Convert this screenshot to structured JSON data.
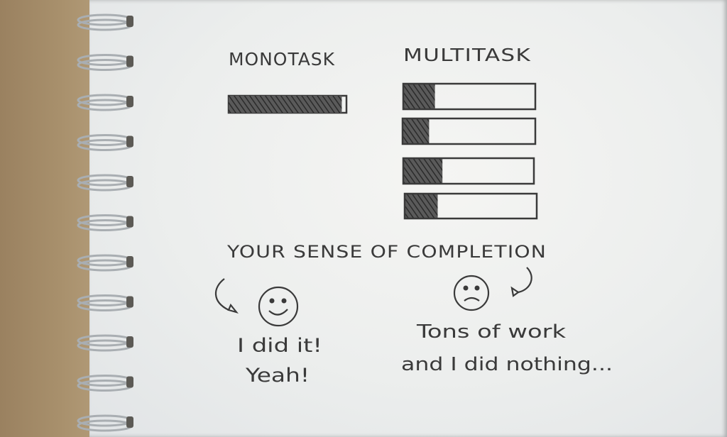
{
  "monotask_label": "MONOTASK",
  "multitask_label": "MULTITASK",
  "caption": "YOUR SENSE OF COMPLETION",
  "happy_text": {
    "line1": "I did it!",
    "line2": "Yeah!"
  },
  "sad_text": {
    "line1": "Tons of work",
    "line2": "and I did nothing..."
  },
  "monotask_progress": 0.96,
  "multitask_progress": [
    0.24,
    0.2,
    0.3,
    0.25
  ],
  "colors": {
    "ink": "#3a3a3a",
    "paper": "#eeefee",
    "cardboard": "#a48c6a",
    "coil": "#9aa0a4"
  }
}
